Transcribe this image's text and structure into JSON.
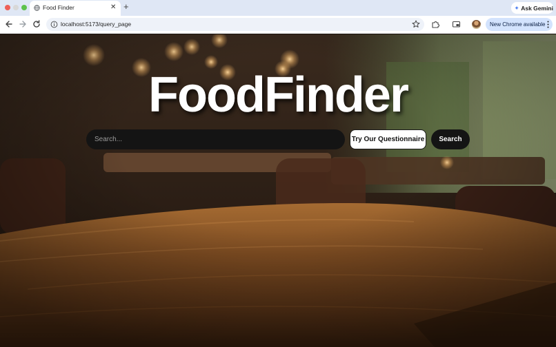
{
  "browser": {
    "tab": {
      "title": "Food Finder"
    },
    "ask_gemini_label": "Ask Gemini",
    "url": "localhost:5173/query_page",
    "update_label": "New Chrome available"
  },
  "page": {
    "brand_title": "FoodFinder",
    "search": {
      "placeholder": "Search...",
      "value": ""
    },
    "questionnaire_label": "Try Our Questionnaire",
    "search_button_label": "Search"
  },
  "icons": {
    "tab_favicon": "globe-icon",
    "tab_close": "close-icon",
    "new_tab": "plus-icon",
    "gemini": "sparkle-icon",
    "back": "back-arrow-icon",
    "forward": "forward-arrow-icon",
    "reload": "reload-icon",
    "site_info": "info-icon",
    "bookmark": "star-icon",
    "extensions": "puzzle-icon",
    "cast": "cast-icon",
    "profile": "avatar",
    "menu": "menu-dots-icon"
  },
  "colors": {
    "tabbar_bg": "#dfe7f5",
    "update_pill_bg": "#d3e3fd",
    "search_bg": "#141414",
    "brand_text": "#ffffff"
  }
}
